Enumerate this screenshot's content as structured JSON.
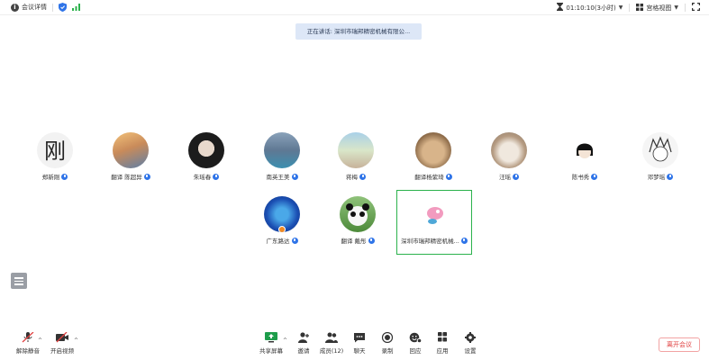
{
  "topbar": {
    "meeting_info_label": "会议详情",
    "timer": "01:10:10(3小时)",
    "view_label": "宫格视图"
  },
  "speaking_banner": "正在讲话: 深圳市瑞邦精密机械有限公...",
  "participants": [
    {
      "name": "郑新刚"
    },
    {
      "name": "翻译 陈超异"
    },
    {
      "name": "朱瑶春"
    },
    {
      "name": "南英王美"
    },
    {
      "name": "蒋梅"
    },
    {
      "name": "翻译杨紫琦"
    },
    {
      "name": "汪瑶"
    },
    {
      "name": "陈书秀"
    },
    {
      "name": "邓梦瑶"
    },
    {
      "name": "广东路达"
    },
    {
      "name": "翻译 戴彤"
    },
    {
      "name": "深圳市瑞邦精密机械..."
    }
  ],
  "toolbar": {
    "unmute": "解除静音",
    "start_video": "开启视频",
    "share": "共享屏幕",
    "invite": "邀请",
    "members": "成员(12)",
    "chat": "聊天",
    "record": "录制",
    "reactions": "回应",
    "apps": "应用",
    "settings": "设置",
    "leave": "离开会议"
  },
  "colors": {
    "accent": "#2f74e8",
    "selected_border": "#2bb24c",
    "leave": "#e04040"
  }
}
